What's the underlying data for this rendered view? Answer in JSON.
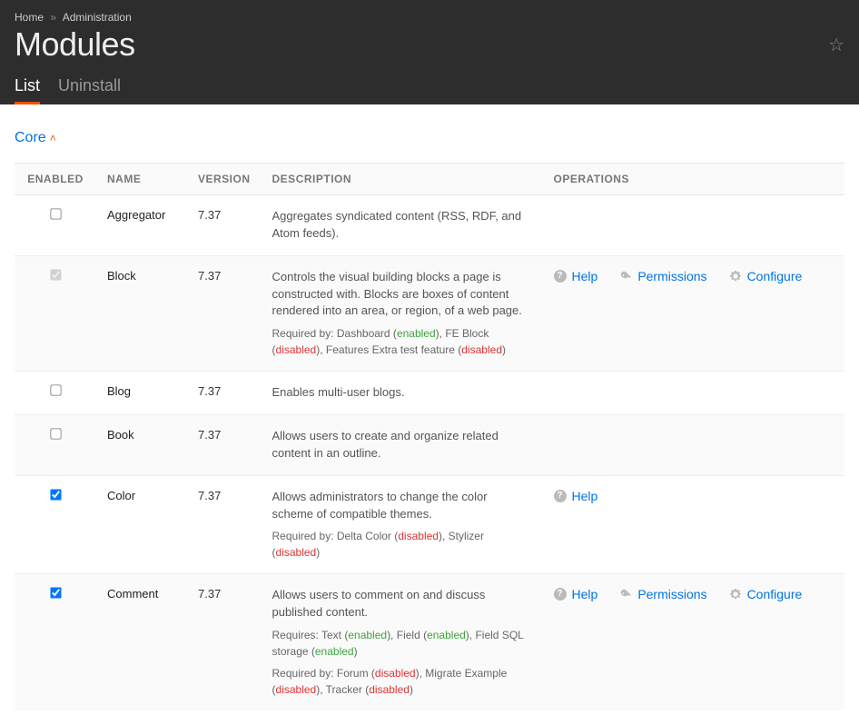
{
  "breadcrumb": {
    "home": "Home",
    "admin": "Administration"
  },
  "page_title": "Modules",
  "tabs": {
    "list": "List",
    "uninstall": "Uninstall"
  },
  "section": {
    "title": "Core"
  },
  "columns": {
    "enabled": "ENABLED",
    "name": "NAME",
    "version": "VERSION",
    "description": "DESCRIPTION",
    "operations": "OPERATIONS"
  },
  "op_labels": {
    "help": "Help",
    "permissions": "Permissions",
    "configure": "Configure"
  },
  "rows": [
    {
      "enabled": false,
      "locked": false,
      "name": "Aggregator",
      "version": "7.37",
      "desc": "Aggregates syndicated content (RSS, RDF, and Atom feeds).",
      "ops": []
    },
    {
      "enabled": true,
      "locked": true,
      "name": "Block",
      "version": "7.37",
      "desc": "Controls the visual building blocks a page is constructed with. Blocks are boxes of content rendered into an area, or region, of a web page.",
      "meta": [
        {
          "prefix": "Required by: ",
          "parts": [
            {
              "t": "Dashboard (",
              "s": "enabled",
              "after": "), "
            },
            {
              "t": "FE Block (",
              "s": "disabled",
              "after": "), "
            },
            {
              "t": "Features Extra test feature (",
              "s": "disabled",
              "after": ")"
            }
          ]
        }
      ],
      "ops": [
        "help",
        "permissions",
        "configure"
      ]
    },
    {
      "enabled": false,
      "locked": false,
      "name": "Blog",
      "version": "7.37",
      "desc": "Enables multi-user blogs.",
      "ops": []
    },
    {
      "enabled": false,
      "locked": false,
      "name": "Book",
      "version": "7.37",
      "desc": "Allows users to create and organize related content in an outline.",
      "ops": []
    },
    {
      "enabled": true,
      "locked": false,
      "name": "Color",
      "version": "7.37",
      "desc": "Allows administrators to change the color scheme of compatible themes.",
      "meta": [
        {
          "prefix": "Required by: ",
          "parts": [
            {
              "t": "Delta Color (",
              "s": "disabled",
              "after": "), "
            },
            {
              "t": "Stylizer (",
              "s": "disabled",
              "after": ")"
            }
          ]
        }
      ],
      "ops": [
        "help"
      ]
    },
    {
      "enabled": true,
      "locked": false,
      "name": "Comment",
      "version": "7.37",
      "desc": "Allows users to comment on and discuss published content.",
      "meta": [
        {
          "prefix": "Requires: ",
          "parts": [
            {
              "t": "Text (",
              "s": "enabled",
              "after": "), "
            },
            {
              "t": "Field (",
              "s": "enabled",
              "after": "), "
            },
            {
              "t": "Field SQL storage (",
              "s": "enabled",
              "after": ")"
            }
          ]
        },
        {
          "prefix": "Required by: ",
          "parts": [
            {
              "t": "Forum (",
              "s": "disabled",
              "after": "), "
            },
            {
              "t": "Migrate Example (",
              "s": "disabled",
              "after": "), "
            },
            {
              "t": "Tracker (",
              "s": "disabled",
              "after": ")"
            }
          ]
        }
      ],
      "ops": [
        "help",
        "permissions",
        "configure"
      ]
    }
  ]
}
